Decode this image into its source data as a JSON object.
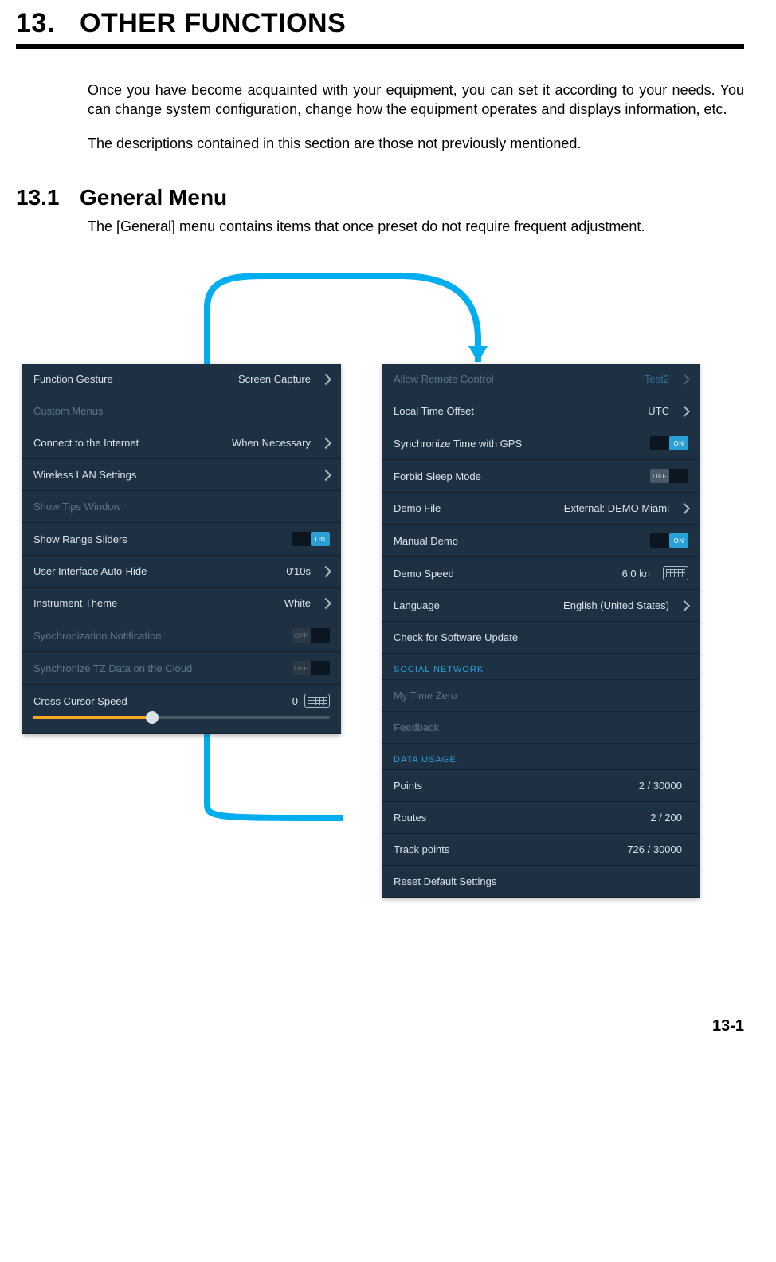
{
  "chapter": {
    "number": "13.",
    "title": "OTHER FUNCTIONS"
  },
  "intro_p1": "Once you have become acquainted with your equipment, you can set it according to your needs. You can change system configuration, change how the equipment operates and displays information, etc.",
  "intro_p2": "The descriptions contained in this section are those not previously mentioned.",
  "section": {
    "number": "13.1",
    "title": "General Menu"
  },
  "section_p": "The [General] menu contains items that once preset do not require frequent adjustment.",
  "left": {
    "function_gesture": {
      "label": "Function Gesture",
      "value": "Screen Capture"
    },
    "custom_menus": {
      "label": "Custom Menus"
    },
    "connect_internet": {
      "label": "Connect to the Internet",
      "value": "When Necessary"
    },
    "wlan": {
      "label": "Wireless LAN Settings"
    },
    "show_tips": {
      "label": "Show Tips Window"
    },
    "show_range_sliders": {
      "label": "Show Range Sliders",
      "toggle": "ON"
    },
    "ui_autohide": {
      "label": "User Interface Auto-Hide",
      "value": "0'10s"
    },
    "instrument_theme": {
      "label": "Instrument Theme",
      "value": "White"
    },
    "sync_notif": {
      "label": "Synchronization Notification",
      "toggle": "OFF"
    },
    "sync_tz_cloud": {
      "label": "Synchronize TZ Data on the Cloud",
      "toggle": "OFF"
    },
    "cross_cursor": {
      "label": "Cross Cursor Speed",
      "value": "0"
    }
  },
  "right": {
    "allow_remote": {
      "label": "Allow Remote Control",
      "value": "Test2"
    },
    "local_time_offset": {
      "label": "Local Time Offset",
      "value": "UTC"
    },
    "sync_gps": {
      "label": "Synchronize Time with GPS",
      "toggle": "ON"
    },
    "forbid_sleep": {
      "label": "Forbid Sleep Mode",
      "toggle": "OFF"
    },
    "demo_file": {
      "label": "Demo File",
      "value": "External: DEMO Miami"
    },
    "manual_demo": {
      "label": "Manual Demo",
      "toggle": "ON"
    },
    "demo_speed": {
      "label": "Demo Speed",
      "value": "6.0 kn"
    },
    "language": {
      "label": "Language",
      "value": "English (United States)"
    },
    "check_update": {
      "label": "Check for Software Update"
    },
    "social_hdr": "SOCIAL NETWORK",
    "my_time_zero": {
      "label": "My Time Zero"
    },
    "feedback": {
      "label": "Feedback"
    },
    "data_usage_hdr": "DATA USAGE",
    "points": {
      "label": "Points",
      "value": "2 / 30000"
    },
    "routes": {
      "label": "Routes",
      "value": "2 / 200"
    },
    "track_points": {
      "label": "Track points",
      "value": "726 / 30000"
    },
    "reset": {
      "label": "Reset Default Settings"
    }
  },
  "page_number": "13-1"
}
